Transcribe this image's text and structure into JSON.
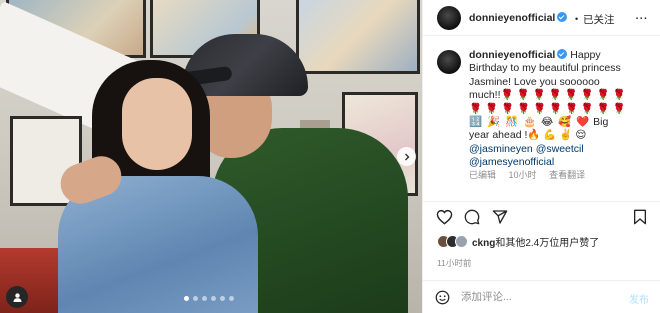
{
  "post": {
    "username": "donnieyenofficial",
    "follow_dot": "•",
    "follow_label": "已关注",
    "more_label": "...",
    "caption": {
      "line1": "Happy",
      "line2": "Birthday to my beautiful princess",
      "line3": "Jasmine! Love you soooooo",
      "line4_text": "much!!",
      "roses1": "🌹 🌹 🌹 🌹 🌹 🌹 🌹 🌹",
      "roses2": "🌹 🌹 🌹 🌹 🌹 🌹 🌹 🌹 🌹 🌹",
      "emoji_row": "🔢 🎉 🎊 🎂 😂 🥰 ❤️",
      "big": "Big",
      "line7": "year ahead !🔥 💪 ✌️ 😌",
      "mention1": "@jasmineyen",
      "mention2": "@sweetcil",
      "mention3": "@jamesyenofficial"
    },
    "meta": {
      "edited": "已编辑",
      "age": "10小时",
      "translate": "查看翻译"
    },
    "likes": {
      "user": "ckng",
      "rest": "和其他2.4万位用户赞了"
    },
    "time": "11小时前",
    "comment": {
      "placeholder": "添加评论...",
      "post_label": "发布"
    },
    "carousel": {
      "slide_count": 6,
      "active_index": 0
    }
  },
  "colors": {
    "verified": "#3897f0",
    "mention": "#00376b",
    "muted": "#8e8e8e",
    "post_disabled": "#b2dffc"
  },
  "icons": [
    "verified-badge-icon",
    "more-icon",
    "heart-icon",
    "comment-icon",
    "share-icon",
    "bookmark-icon",
    "emoji-icon",
    "chevron-right-icon",
    "user-tag-icon"
  ]
}
